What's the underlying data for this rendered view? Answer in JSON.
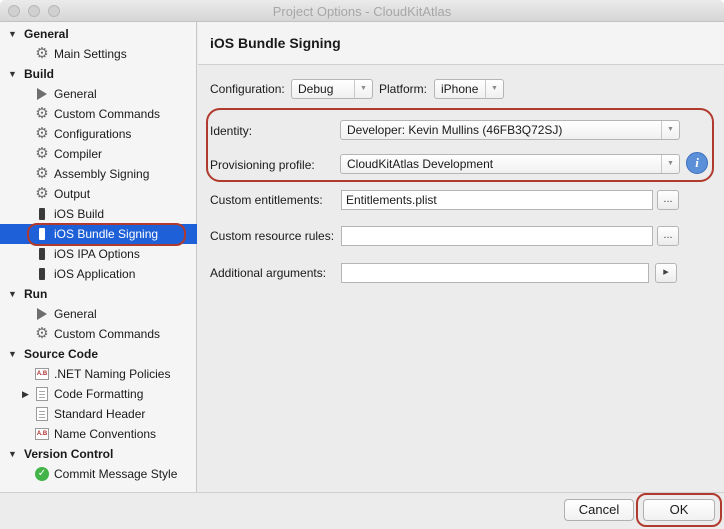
{
  "window": {
    "title": "Project Options - CloudKitAtlas"
  },
  "sidebar": {
    "rows": [
      {
        "kind": "section",
        "label": "General",
        "expanded": true
      },
      {
        "kind": "item",
        "icon": "gear-icon",
        "label": "Main Settings"
      },
      {
        "kind": "section",
        "label": "Build",
        "expanded": true
      },
      {
        "kind": "item",
        "icon": "build-icon",
        "label": "General"
      },
      {
        "kind": "item",
        "icon": "gear-icon",
        "label": "Custom Commands"
      },
      {
        "kind": "item",
        "icon": "gear-icon",
        "label": "Configurations"
      },
      {
        "kind": "item",
        "icon": "gear-icon",
        "label": "Compiler"
      },
      {
        "kind": "item",
        "icon": "gear-icon",
        "label": "Assembly Signing"
      },
      {
        "kind": "item",
        "icon": "gear-icon",
        "label": "Output"
      },
      {
        "kind": "item",
        "icon": "iphone-icon",
        "label": "iOS Build"
      },
      {
        "kind": "item",
        "icon": "iphone-icon",
        "label": "iOS Bundle Signing",
        "selected": true
      },
      {
        "kind": "item",
        "icon": "iphone-icon",
        "label": "iOS IPA Options"
      },
      {
        "kind": "item",
        "icon": "iphone-icon",
        "label": "iOS Application"
      },
      {
        "kind": "section",
        "label": "Run",
        "expanded": true
      },
      {
        "kind": "item",
        "icon": "play-icon",
        "label": "General"
      },
      {
        "kind": "item",
        "icon": "gear-icon",
        "label": "Custom Commands"
      },
      {
        "kind": "section",
        "label": "Source Code",
        "expanded": true
      },
      {
        "kind": "item",
        "icon": "naming-policy-icon",
        "label": ".NET Naming Policies"
      },
      {
        "kind": "item",
        "icon": "document-icon",
        "label": "Code Formatting",
        "collapsed_child": true
      },
      {
        "kind": "item",
        "icon": "document-icon",
        "label": "Standard Header"
      },
      {
        "kind": "item",
        "icon": "naming-policy-icon",
        "label": "Name Conventions"
      },
      {
        "kind": "section",
        "label": "Version Control",
        "expanded": true
      },
      {
        "kind": "item",
        "icon": "check-icon",
        "label": "Commit Message Style"
      }
    ]
  },
  "panel": {
    "title": "iOS Bundle Signing",
    "configuration_label": "Configuration:",
    "configuration_value": "Debug",
    "platform_label": "Platform:",
    "platform_value": "iPhone",
    "identity_label": "Identity:",
    "identity_value": "Developer: Kevin Mullins (46FB3Q72SJ)",
    "provisioning_label": "Provisioning profile:",
    "provisioning_value": "CloudKitAtlas Development",
    "entitlements_label": "Custom entitlements:",
    "entitlements_value": "Entitlements.plist",
    "resource_rules_label": "Custom resource rules:",
    "resource_rules_value": "",
    "additional_args_label": "Additional arguments:",
    "additional_args_value": "",
    "browse_label": "...",
    "run_label": "▸",
    "info_label": "i"
  },
  "footer": {
    "cancel_label": "Cancel",
    "ok_label": "OK"
  },
  "colors": {
    "selection": "#1e60d8",
    "highlight_ring": "#b03a2e",
    "info": "#5b8fd8",
    "success": "#43b447"
  }
}
